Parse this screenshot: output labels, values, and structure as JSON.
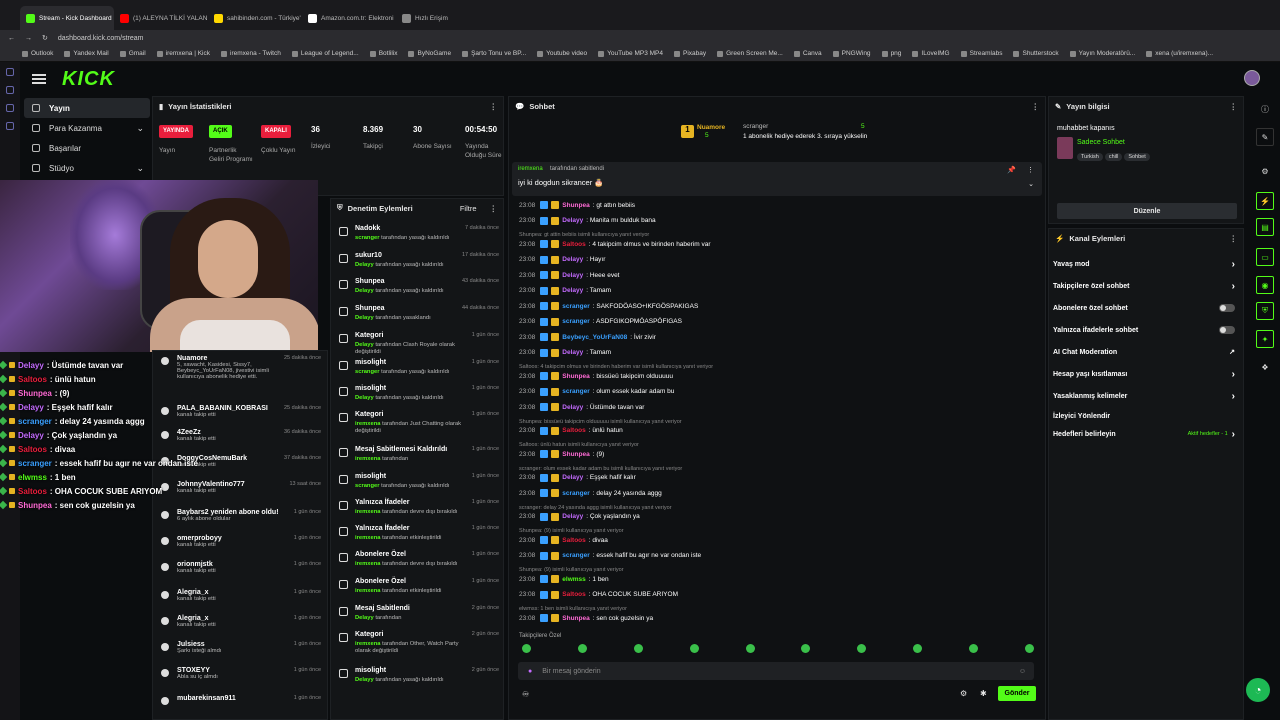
{
  "browser": {
    "tabs": [
      {
        "label": "Stream - Kick Dashboard",
        "color": "#53fc18",
        "active": true
      },
      {
        "label": "(1) ALEYNA TİLKİ YALAN",
        "color": "#ff0000"
      },
      {
        "label": "sahibinden.com - Türkiye'",
        "color": "#ffd800"
      },
      {
        "label": "Amazon.com.tr: Elektroni",
        "color": "#ffffff"
      },
      {
        "label": "Hızlı Erişim",
        "color": "#888888"
      }
    ],
    "url": "dashboard.kick.com/stream",
    "bookmarks": [
      "Outlook",
      "Yandex Mail",
      "Gmail",
      "iremxena | Kick",
      "iremxena - Twitch",
      "League of Legend...",
      "Botlilix",
      "ByNoGame",
      "Şarto Tonu ve BP...",
      "Youtube video",
      "YouTube MP3 MP4",
      "Pixabay",
      "Green Screen Me...",
      "Canva",
      "PNGWing",
      "png",
      "ILoveIMG",
      "Streamlabs",
      "Shutterstock",
      "Yayın Moderatörü...",
      "xena (u/iremxena)..."
    ]
  },
  "kick": {
    "logo": "KICK"
  },
  "leftnav": [
    {
      "label": "Yayın",
      "active": true
    },
    {
      "label": "Para Kazanma",
      "chevron": true
    },
    {
      "label": "Başarılar"
    },
    {
      "label": "Stüdyo",
      "chevron": true
    }
  ],
  "stats": {
    "title": "Yayın İstatistikleri",
    "items": [
      {
        "badge": "YAYINDA",
        "badge_color": "#e91e3c",
        "label": "Yayın"
      },
      {
        "badge": "AÇIK",
        "badge_color": "#53fc18",
        "label": "Partnerlik Geliri Programı"
      },
      {
        "badge": "KAPALI",
        "badge_color": "#e91e3c",
        "label": "Çoklu Yayın"
      },
      {
        "value": "36",
        "label": "İzleyici"
      },
      {
        "value": "8.369",
        "label": "Takipçi"
      },
      {
        "value": "30",
        "label": "Abone Sayısı"
      },
      {
        "value": "00:54:50",
        "label": "Yayında Olduğu Süre"
      }
    ]
  },
  "overlay_chat": [
    {
      "user": "Delayy",
      "color": "#c46bff",
      "msg": ": Üstümde tavan var"
    },
    {
      "user": "Saltoos",
      "color": "#e91e3c",
      "msg": ": ünlü hatun"
    },
    {
      "user": "Shunpea",
      "color": "#ff6ad5",
      "msg": ": (9)"
    },
    {
      "user": "Delayy",
      "color": "#c46bff",
      "msg": ": Eşşek hafif kalır"
    },
    {
      "user": "scranger",
      "color": "#3aa0ff",
      "msg": ": delay 24 yasında aggg"
    },
    {
      "user": "Delayy",
      "color": "#c46bff",
      "msg": ": Çok yaşlandın ya"
    },
    {
      "user": "Saltoos",
      "color": "#e91e3c",
      "msg": ": divaa"
    },
    {
      "user": "scranger",
      "color": "#3aa0ff",
      "msg": ": essek hafif bu agır ne var ondan iste"
    },
    {
      "user": "elwmss",
      "color": "#53fc18",
      "msg": ": 1 ben"
    },
    {
      "user": "Saltoos",
      "color": "#e91e3c",
      "msg": ": OHA COCUK SUBE ARIYOM"
    },
    {
      "user": "Shunpea",
      "color": "#ff6ad5",
      "msg": ": sen cok guzelsin ya"
    }
  ],
  "activity": [
    {
      "name": "Nuamore",
      "sub": "5, xawacht, Kasidesi, Sissy7, Beybeyc_YoUrFaN08, jivestivi isimli kullanıcıya abonelik hediye etti.",
      "time": "25 dakika önce"
    },
    {
      "name": "PALA_BABANIN_KOBRASI",
      "sub": "kanalı takip etti",
      "time": "25 dakika önce"
    },
    {
      "name": "4ZeeZz",
      "sub": "kanalı takip etti",
      "time": "36 dakika önce"
    },
    {
      "name": "DoggyCosNemuBark",
      "sub": "kanalı takip etti",
      "time": "37 dakika önce"
    },
    {
      "name": "JohnnyValentino777",
      "sub": "kanalı takip etti",
      "time": "13 saat önce"
    },
    {
      "name": "Baybars2 yeniden abone oldu!",
      "sub": "6 aylık abone oldular",
      "time": "1 gün önce"
    },
    {
      "name": "omerproboyy",
      "sub": "kanalı takip etti",
      "time": "1 gün önce"
    },
    {
      "name": "orionmjstk",
      "sub": "kanalı takip etti",
      "time": "1 gün önce"
    },
    {
      "name": "Alegria_x",
      "sub": "kanalı takip etti",
      "time": "1 gün önce"
    },
    {
      "name": "Alegria_x",
      "sub": "kanalı takip etti",
      "time": "1 gün önce"
    },
    {
      "name": "Julsiess",
      "sub": "Şarkı isteği almdı",
      "time": "1 gün önce"
    },
    {
      "name": "STOXEYY",
      "sub": "Abla su iç almdı",
      "time": "1 gün önce"
    },
    {
      "name": "mubarekinsan911",
      "sub": "",
      "time": "1 gün önce"
    }
  ],
  "moderation": {
    "title": "Denetim Eylemleri",
    "filter": "Filtre",
    "items": [
      {
        "title": "Nadokk",
        "user": "scranger",
        "rest": " tarafından yasağı kaldırıldı",
        "time": "7 dakika önce"
      },
      {
        "title": "sukur10",
        "user": "Delayy",
        "rest": " tarafından yasağı kaldırıldı",
        "time": "17 dakika önce"
      },
      {
        "title": "Shunpea",
        "user": "Delayy",
        "rest": " tarafından yasağı kaldırıldı",
        "time": "43 dakika önce"
      },
      {
        "title": "Shunpea",
        "user": "Delayy",
        "rest": " tarafından yasaklandı",
        "time": "44 dakika önce"
      },
      {
        "title": "Kategori",
        "user": "Delayy",
        "rest": " tarafından Clash Royale olarak değiştirildi",
        "time": "1 gün önce"
      },
      {
        "title": "misolight",
        "user": "scranger",
        "rest": " tarafından yasağı kaldırıldı",
        "time": "1 gün önce"
      },
      {
        "title": "misolight",
        "user": "Delayy",
        "rest": " tarafından yasağı kaldırıldı",
        "time": "1 gün önce"
      },
      {
        "title": "Kategori",
        "user": "iremxena",
        "rest": " tarafından Just Chatting olarak değiştirildi",
        "time": "1 gün önce"
      },
      {
        "title": "Mesaj Sabitlemesi Kaldırıldı",
        "user": "iremxena",
        "rest": " tarafından",
        "time": "1 gün önce"
      },
      {
        "title": "misolight",
        "user": "scranger",
        "rest": " tarafından yasağı kaldırıldı",
        "time": "1 gün önce"
      },
      {
        "title": "Yalnızca İfadeler",
        "user": "iremxena",
        "rest": " tarafından devre dışı bırakıldı",
        "time": "1 gün önce"
      },
      {
        "title": "Yalnızca İfadeler",
        "user": "iremxena",
        "rest": " tarafından etkinleştirildi",
        "time": "1 gün önce"
      },
      {
        "title": "Abonelere Özel",
        "user": "iremxena",
        "rest": " tarafından devre dışı bırakıldı",
        "time": "1 gün önce"
      },
      {
        "title": "Abonelere Özel",
        "user": "iremxena",
        "rest": " tarafından etkinleştirildi",
        "time": "1 gün önce"
      },
      {
        "title": "Mesaj Sabitlendi",
        "user": "Delayy",
        "rest": " tarafından",
        "time": "2 gün önce"
      },
      {
        "title": "Kategori",
        "user": "iremxena",
        "rest": " tarafından Other, Watch Party olarak değiştirildi",
        "time": "2 gün önce"
      },
      {
        "title": "misolight",
        "user": "Delayy",
        "rest": " tarafından yasağı kaldırıldı",
        "time": "2 gün önce"
      }
    ]
  },
  "chat": {
    "title": "Sohbet",
    "gift_sender": "Nuamore",
    "gift_count": "5",
    "gift_user": "scranger",
    "gift_user_count": "5",
    "gift_text": "1 abonelik hediye ederek 3. sıraya yükselin",
    "pinned_by": "iremxena",
    "pinned_label": "tarafından sabitlendi",
    "pinned_msg": "iyi ki dogdun sikrancer 🎂",
    "lines": [
      {
        "t": "23:08",
        "u": "Shunpea",
        "c": "#ff6ad5",
        "m": ": gt attın bebiis"
      },
      {
        "t": "23:08",
        "u": "Delayy",
        "c": "#c46bff",
        "m": ": Manita mı bulduk bana"
      },
      {
        "reply": "Shunpea: gt attin bebiis isimli kullanıcıya yanıt veriyor"
      },
      {
        "t": "23:08",
        "u": "Saltoos",
        "c": "#e91e3c",
        "m": ": 4 takipcim olmus ve birinden haberim var"
      },
      {
        "t": "23:08",
        "u": "Delayy",
        "c": "#c46bff",
        "m": ": Hayır"
      },
      {
        "t": "23:08",
        "u": "Delayy",
        "c": "#c46bff",
        "m": ": Heee evet"
      },
      {
        "t": "23:08",
        "u": "Delayy",
        "c": "#c46bff",
        "m": ": Tamam"
      },
      {
        "t": "23:08",
        "u": "scranger",
        "c": "#3aa0ff",
        "m": ": SAKFODÖASO+IKFGÖSPAKIGAS"
      },
      {
        "t": "23:08",
        "u": "scranger",
        "c": "#3aa0ff",
        "m": ": ASDFGIKOPMÖASPÖFIGAS"
      },
      {
        "t": "23:08",
        "u": "Beybeyc_YoUrFaN08",
        "c": "#3aa0ff",
        "m": ": İvir zivir"
      },
      {
        "t": "23:08",
        "u": "Delayy",
        "c": "#c46bff",
        "m": ": Tamam"
      },
      {
        "reply": "Saltoos: 4 takipcim olmus ve birinden haberim var isimli kullanıcıya yanıt veriyor"
      },
      {
        "t": "23:08",
        "u": "Shunpea",
        "c": "#ff6ad5",
        "m": ": bissüeü takipcim olduuuuu"
      },
      {
        "t": "23:08",
        "u": "scranger",
        "c": "#3aa0ff",
        "m": ": olum essek kadar adam bu"
      },
      {
        "t": "23:08",
        "u": "Delayy",
        "c": "#c46bff",
        "m": ": Üstümde tavan var"
      },
      {
        "reply": "Shunpea: bissüeü takipcim olduuuuu isimli kullanıcıya yanıt veriyor"
      },
      {
        "t": "23:08",
        "u": "Saltoos",
        "c": "#e91e3c",
        "m": ": ünlü hatun"
      },
      {
        "reply": "Saltoos: ünlü hatun isimli kullanıcıya yanıt veriyor"
      },
      {
        "t": "23:08",
        "u": "Shunpea",
        "c": "#ff6ad5",
        "m": ": (9)"
      },
      {
        "reply": "scranger: olum essek kadar adam bu isimli kullanıcıya yanıt veriyor"
      },
      {
        "t": "23:08",
        "u": "Delayy",
        "c": "#c46bff",
        "m": ": Eşşek hafif kalır"
      },
      {
        "t": "23:08",
        "u": "scranger",
        "c": "#3aa0ff",
        "m": ": delay 24 yasında aggg"
      },
      {
        "reply": "scranger: delay 24 yasında aggg isimli kullanıcıya yanıt veriyor"
      },
      {
        "t": "23:08",
        "u": "Delayy",
        "c": "#c46bff",
        "m": ": Çok yaşlandın ya"
      },
      {
        "reply": "Shunpea: (9) isimli kullanıcıya yanıt veriyor"
      },
      {
        "t": "23:08",
        "u": "Saltoos",
        "c": "#e91e3c",
        "m": ": divaa"
      },
      {
        "t": "23:08",
        "u": "scranger",
        "c": "#3aa0ff",
        "m": ": essek hafif bu agır ne var ondan iste"
      },
      {
        "reply": "Shunpea: (9) isimli kullanıcıya yanıt veriyor"
      },
      {
        "t": "23:08",
        "u": "elwmss",
        "c": "#53fc18",
        "m": ": 1 ben"
      },
      {
        "t": "23:08",
        "u": "Saltoos",
        "c": "#e91e3c",
        "m": ": OHA COCUK SUBE ARIYOM"
      },
      {
        "reply": "elwmss: 1 ben isimli kullanıcıya yanıt veriyor"
      },
      {
        "t": "23:08",
        "u": "Shunpea",
        "c": "#ff6ad5",
        "m": ": sen cok guzelsin ya"
      }
    ],
    "followers_only": "Takipçilere Özel",
    "input_placeholder": "Bir mesaj gönderin",
    "send": "Gönder"
  },
  "stream_info": {
    "title": "Yayın bilgisi",
    "stream_title": "muhabbet kapanıs",
    "category": "Sadece Sohbet",
    "tags": [
      "Turkish",
      "chill",
      "Sohbet"
    ],
    "edit": "Düzenle"
  },
  "channel_actions": {
    "title": "Kanal Eylemleri",
    "items": [
      {
        "label": "Yavaş mod",
        "type": "chevron"
      },
      {
        "label": "Takipçilere özel sohbet",
        "type": "chevron"
      },
      {
        "label": "Abonelere özel sohbet",
        "type": "toggle"
      },
      {
        "label": "Yalnızca ifadelerle sohbet",
        "type": "toggle"
      },
      {
        "label": "AI Chat Moderation",
        "type": "ext"
      },
      {
        "label": "Hesap yaşı kısıtlaması",
        "type": "chevron"
      },
      {
        "label": "Yasaklanmış kelimeler",
        "type": "chevron"
      },
      {
        "label": "İzleyici Yönlendir",
        "type": "none"
      },
      {
        "label": "Hedefleri belirleyin",
        "type": "chevron",
        "extra": "Aktif hedefler - 1"
      }
    ]
  },
  "colors": {
    "accent": "#53fc18",
    "bg": "#0b0d0f",
    "panel": "#131517"
  }
}
